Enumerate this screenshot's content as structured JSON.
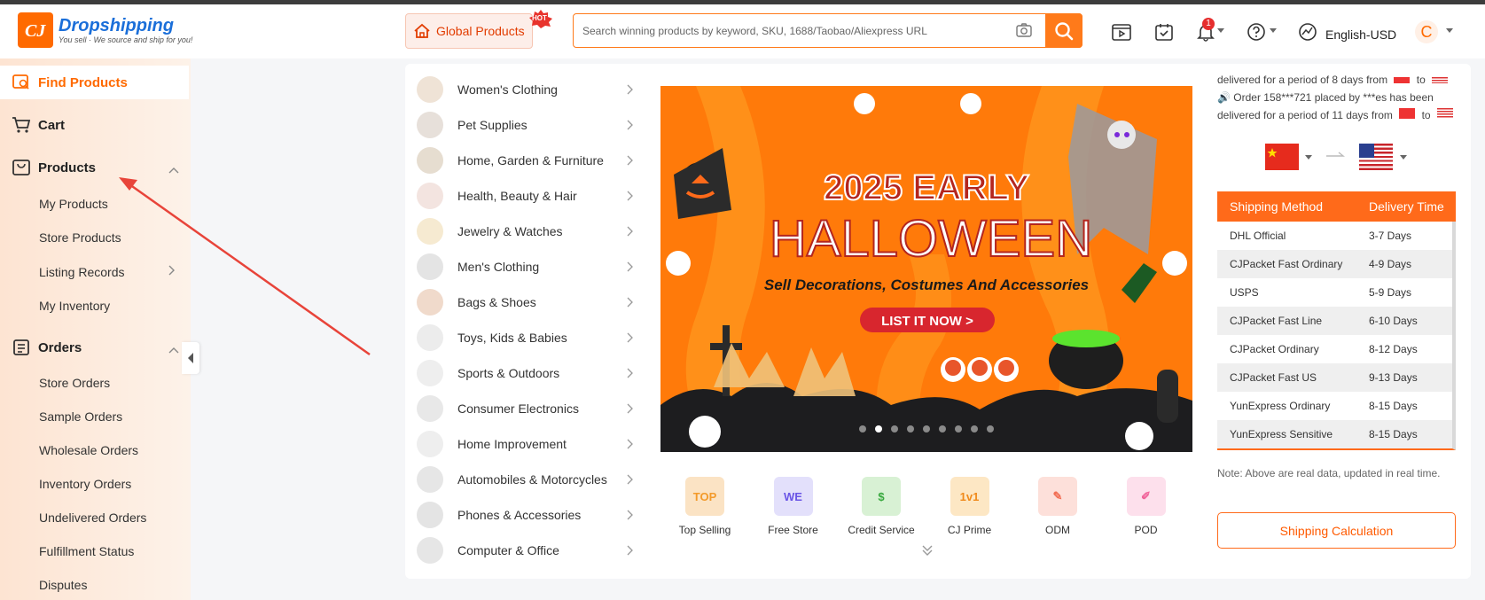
{
  "header": {
    "logo_name": "Dropshipping",
    "logo_tagline": "You sell · We source and ship for you!",
    "global_products": "Global Products",
    "hot_badge": "HOT",
    "search_placeholder": "Search winning products by keyword, SKU, 1688/Taobao/Aliexpress URL",
    "notification_count": "1",
    "language": "English-USD",
    "avatar_letter": "C"
  },
  "sidebar": {
    "find_products": "Find Products",
    "cart": "Cart",
    "products": {
      "label": "Products",
      "items": [
        "My Products",
        "Store Products",
        "Listing Records",
        "My Inventory"
      ]
    },
    "orders": {
      "label": "Orders",
      "items": [
        "Store Orders",
        "Sample Orders",
        "Wholesale Orders",
        "Inventory Orders",
        "Undelivered Orders",
        "Fulfillment Status",
        "Disputes"
      ]
    }
  },
  "categories": [
    "Women's Clothing",
    "Pet Supplies",
    "Home, Garden & Furniture",
    "Health, Beauty & Hair",
    "Jewelry & Watches",
    "Men's Clothing",
    "Bags & Shoes",
    "Toys, Kids & Babies",
    "Sports & Outdoors",
    "Consumer Electronics",
    "Home Improvement",
    "Automobiles & Motorcycles",
    "Phones & Accessories",
    "Computer & Office"
  ],
  "banner": {
    "line1": "2025 EARLY",
    "line2": "HALLOWEEN",
    "subtitle": "Sell Decorations, Costumes And Accessories",
    "cta": "LIST IT NOW >",
    "slide_count": 9,
    "active_slide": 1
  },
  "features": [
    {
      "label": "Top Selling",
      "icon": "top-selling-icon",
      "glyph": "TOP",
      "color": "#fbe3c4",
      "fg": "#f39a2a"
    },
    {
      "label": "Free Store",
      "icon": "free-store-icon",
      "glyph": "WE",
      "color": "#e3e0fb",
      "fg": "#6a55e6"
    },
    {
      "label": "Credit Service",
      "icon": "credit-service-icon",
      "glyph": "$",
      "color": "#d8f1d4",
      "fg": "#37a83d"
    },
    {
      "label": "CJ Prime",
      "icon": "cj-prime-icon",
      "glyph": "1v1",
      "color": "#fde7c4",
      "fg": "#f08a1b"
    },
    {
      "label": "ODM",
      "icon": "odm-icon",
      "glyph": "✎",
      "color": "#fde0da",
      "fg": "#f26f55"
    },
    {
      "label": "POD",
      "icon": "pod-icon",
      "glyph": "✐",
      "color": "#fde0ec",
      "fg": "#f0649a"
    }
  ],
  "ticker": {
    "line1": "delivered for a period of 8 days from",
    "line2": "Order 158***721 placed by ***es has been",
    "line3": "delivered for a period of 11 days from",
    "to": "to"
  },
  "shipping": {
    "head_method": "Shipping Method",
    "head_time": "Delivery Time",
    "rows": [
      {
        "method": "DHL Official",
        "time": "3-7 Days"
      },
      {
        "method": "CJPacket Fast Ordinary",
        "time": "4-9 Days"
      },
      {
        "method": "USPS",
        "time": "5-9 Days"
      },
      {
        "method": "CJPacket Fast Line",
        "time": "6-10 Days"
      },
      {
        "method": "CJPacket Ordinary",
        "time": "8-12 Days"
      },
      {
        "method": "CJPacket Fast US",
        "time": "9-13 Days"
      },
      {
        "method": "YunExpress Ordinary",
        "time": "8-15 Days"
      },
      {
        "method": "YunExpress Sensitive",
        "time": "8-15 Days"
      }
    ],
    "note": "Note: Above are real data, updated in real time.",
    "calc_button": "Shipping Calculation"
  },
  "colors": {
    "accent": "#ff6a00",
    "banner_bg": "#ff7a0a",
    "cta_red": "#d8262e"
  }
}
